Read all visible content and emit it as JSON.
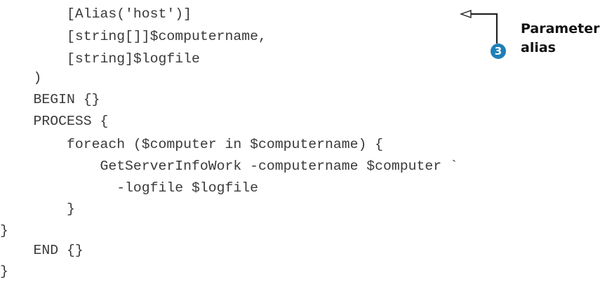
{
  "code": {
    "lines": [
      "        [Alias('host')]",
      "        [string[]]$computername,",
      "        [string]$logfile",
      "    )",
      "    BEGIN {}",
      "    PROCESS {",
      "        foreach ($computer in $computername) {",
      "            GetServerInfoWork -computername $computer `",
      "              -logfile $logfile",
      "        }",
      "}",
      "    END {}",
      "}"
    ]
  },
  "annotation": {
    "number": "3",
    "label_line1": "Parameter",
    "label_line2": "alias",
    "badge_color": "#1f7fb6",
    "arrow_color": "#222222"
  }
}
